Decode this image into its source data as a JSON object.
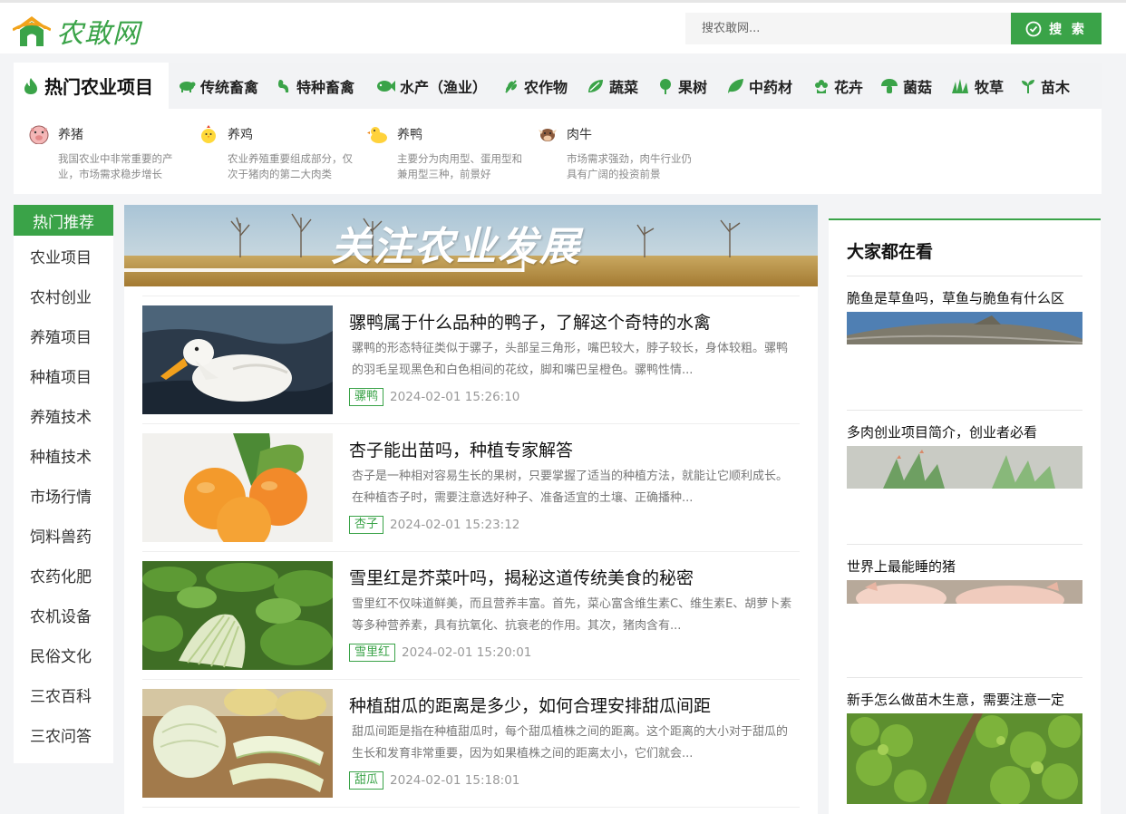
{
  "header": {
    "logo_text": "农敢网",
    "search_placeholder": "搜农敢网...",
    "search_button": "搜 索"
  },
  "categories": {
    "active": "热门农业项目",
    "items": [
      "传统畜禽",
      "特种畜禽",
      "水产（渔业）",
      "农作物",
      "蔬菜",
      "果树",
      "中药材",
      "花卉",
      "菌菇",
      "牧草",
      "苗木"
    ]
  },
  "subcategories": [
    {
      "name": "养猪",
      "desc": "我国农业中非常重要的产业，市场需求稳步增长",
      "icon": "pig-icon"
    },
    {
      "name": "养鸡",
      "desc": "农业养殖重要组成部分，仅次于猪肉的第二大肉类",
      "icon": "chick-icon"
    },
    {
      "name": "养鸭",
      "desc": "主要分为肉用型、蛋用型和兼用型三种，前景好",
      "icon": "duck-icon"
    },
    {
      "name": "肉牛",
      "desc": "市场需求强劲，肉牛行业仍具有广阔的投资前景",
      "icon": "cow-icon"
    }
  ],
  "left_nav": {
    "header": "热门推荐",
    "items": [
      "农业项目",
      "农村创业",
      "养殖项目",
      "种植项目",
      "养殖技术",
      "种植技术",
      "市场行情",
      "饲料兽药",
      "农药化肥",
      "农机设备",
      "民俗文化",
      "三农百科",
      "三农问答"
    ]
  },
  "banner": {
    "text": "关注农业发展"
  },
  "articles": [
    {
      "title": "骡鸭属于什么品种的鸭子，了解这个奇特的水禽",
      "desc": "骡鸭的形态特征类似于骡子，头部呈三角形，嘴巴较大，脖子较长，身体较粗。骡鸭的羽毛呈现黑色和白色相间的花纹，脚和嘴巴呈橙色。骡鸭性情...",
      "tag": "骡鸭",
      "date": "2024-02-01 15:26:10"
    },
    {
      "title": "杏子能出苗吗，种植专家解答",
      "desc": "杏子是一种相对容易生长的果树，只要掌握了适当的种植方法，就能让它顺利成长。在种植杏子时，需要注意选好种子、准备适宜的土壤、正确播种...",
      "tag": "杏子",
      "date": "2024-02-01 15:23:12"
    },
    {
      "title": "雪里红是芥菜叶吗，揭秘这道传统美食的秘密",
      "desc": "雪里红不仅味道鲜美，而且营养丰富。首先，菜心富含维生素C、维生素E、胡萝卜素等多种营养素，具有抗氧化、抗衰老的作用。其次，猪肉含有...",
      "tag": "雪里红",
      "date": "2024-02-01 15:20:01"
    },
    {
      "title": "种植甜瓜的距离是多少，如何合理安排甜瓜间距",
      "desc": "甜瓜间距是指在种植甜瓜时，每个甜瓜植株之间的距离。这个距离的大小对于甜瓜的生长和发育非常重要，因为如果植株之间的距离太小，它们就会...",
      "tag": "甜瓜",
      "date": "2024-02-01 15:18:01"
    }
  ],
  "sidebar": {
    "title": "大家都在看",
    "items": [
      {
        "title": "脆鱼是草鱼吗，草鱼与脆鱼有什么区"
      },
      {
        "title": "多肉创业项目简介，创业者必看"
      },
      {
        "title": "世界上最能睡的猪"
      },
      {
        "title": "新手怎么做苗木生意，需要注意一定"
      }
    ]
  },
  "colors": {
    "brand": "#3aa348"
  }
}
